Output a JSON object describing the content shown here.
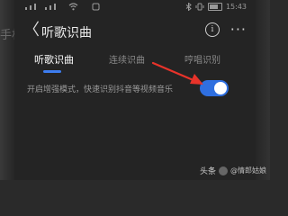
{
  "backdrop": {
    "left_text": "手机"
  },
  "status_bar": {
    "wifi_icon": "wifi-icon",
    "battery_icon": "battery-icon",
    "bluetooth_icon": "bluetooth-icon",
    "battery_label": "■",
    "time": "15:43"
  },
  "header": {
    "back_icon": "chevron-left-icon",
    "back_glyph": "〈",
    "title": "听歌识曲",
    "info_icon": "info-icon",
    "info_glyph": "i",
    "more_icon": "more-icon",
    "more_glyph": "···"
  },
  "tabs": [
    {
      "label": "听歌识曲",
      "active": true
    },
    {
      "label": "连续识曲",
      "active": false
    },
    {
      "label": "哼唱识别",
      "active": false
    }
  ],
  "setting": {
    "label": "开启增强模式，快速识别抖音等视频音乐",
    "toggle_on": true
  },
  "colors": {
    "accent": "#2f6fe0",
    "annotation_arrow": "#e8332a"
  },
  "watermark": {
    "platform": "头条",
    "author": "@情郎姑娘"
  }
}
